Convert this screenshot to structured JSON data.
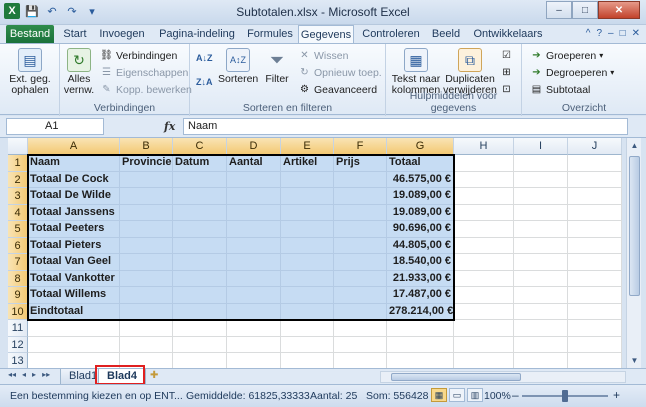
{
  "window": {
    "title": "Subtotalen.xlsx - Microsoft Excel",
    "qat": {
      "logo": "X",
      "save_icon": "💾",
      "undo_icon": "↶",
      "redo_icon": "↷",
      "customize_icon": "▾"
    },
    "buttons": {
      "minimize": "–",
      "maximize": "□",
      "close": "✕"
    }
  },
  "tabs": [
    "Bestand",
    "Start",
    "Invoegen",
    "Pagina-indeling",
    "Formules",
    "Gegevens",
    "Controleren",
    "Beeld",
    "Ontwikkelaars"
  ],
  "active_tab": "Gegevens",
  "help_icons": [
    "^",
    "?",
    "–",
    "□",
    "✕"
  ],
  "ribbon": {
    "ext_data": {
      "label1": "Ext. geg.",
      "label2": "ophalen"
    },
    "refresh_all": {
      "label1": "Alles",
      "label2": "vernw."
    },
    "connections": {
      "connections": "Verbindingen",
      "properties": "Eigenschappen",
      "edit_links": "Kopp. bewerken",
      "group": "Verbindingen"
    },
    "sort": {
      "sort_az": "A↓Z",
      "sort_za": "Z↓A",
      "sort": "Sorteren",
      "filter": "Filter",
      "clear": "Wissen",
      "reapply": "Opnieuw toep.",
      "advanced": "Geavanceerd",
      "group": "Sorteren en filteren"
    },
    "data_tools": {
      "text_to_columns1": "Tekst naar",
      "text_to_columns2": "kolommen",
      "remove_duplicates1": "Duplicaten",
      "remove_duplicates2": "verwijderen",
      "group": "Hulpmiddelen voor gegevens"
    },
    "outline": {
      "group_btn": "Groeperen",
      "ungroup": "Degroeperen",
      "subtotal": "Subtotaal",
      "group": "Overzicht"
    }
  },
  "formula_bar": {
    "name_box": "A1",
    "fx": "fx",
    "content": "Naam"
  },
  "columns": [
    "A",
    "B",
    "C",
    "D",
    "E",
    "F",
    "G",
    "H",
    "I",
    "J"
  ],
  "rows": [
    "1",
    "2",
    "3",
    "4",
    "5",
    "6",
    "7",
    "8",
    "9",
    "10",
    "11",
    "12",
    "13"
  ],
  "table": {
    "headers": [
      "Naam",
      "Provincie",
      "Datum",
      "Aantal",
      "Artikel",
      "Prijs",
      "Totaal"
    ],
    "data": [
      [
        "Totaal De Cock",
        "",
        "",
        "",
        "",
        "",
        "46.575,00 €"
      ],
      [
        "Totaal De Wilde",
        "",
        "",
        "",
        "",
        "",
        "19.089,00 €"
      ],
      [
        "Totaal Janssens",
        "",
        "",
        "",
        "",
        "",
        "19.089,00 €"
      ],
      [
        "Totaal Peeters",
        "",
        "",
        "",
        "",
        "",
        "90.696,00 €"
      ],
      [
        "Totaal Pieters",
        "",
        "",
        "",
        "",
        "",
        "44.805,00 €"
      ],
      [
        "Totaal Van Geel",
        "",
        "",
        "",
        "",
        "",
        "18.540,00 €"
      ],
      [
        "Totaal Vankotter",
        "",
        "",
        "",
        "",
        "",
        "21.933,00 €"
      ],
      [
        "Totaal Willems",
        "",
        "",
        "",
        "",
        "",
        "17.487,00 €"
      ],
      [
        "Eindtotaal",
        "",
        "",
        "",
        "",
        "",
        "278.214,00 €"
      ]
    ]
  },
  "sheets": [
    "Blad1",
    "Blad4"
  ],
  "active_sheet": "Blad4",
  "sheet_nav": [
    "◂◂",
    "◂",
    "▸",
    "▸▸"
  ],
  "status": {
    "message": "Een bestemming kiezen en op ENT...",
    "average": "Gemiddelde: 61825,33333",
    "count": "Aantal: 25",
    "sum": "Som: 556428",
    "zoom": "100%",
    "zoom_minus": "–",
    "zoom_plus": "+"
  }
}
